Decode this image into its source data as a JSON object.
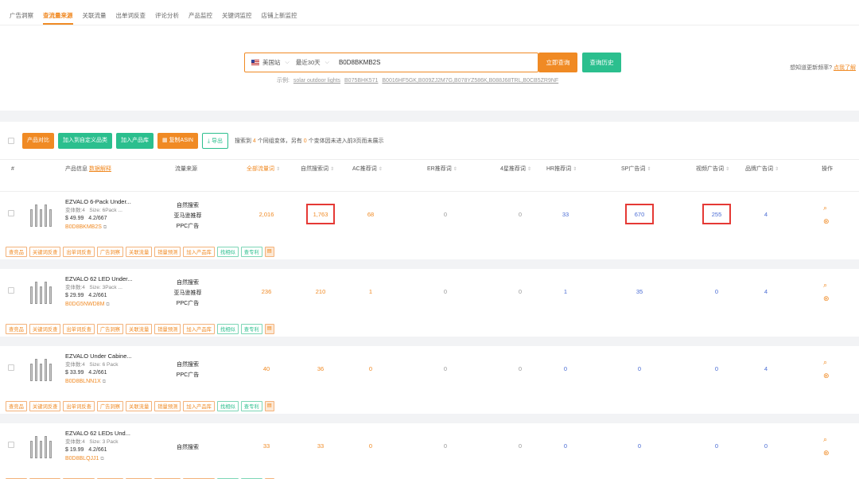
{
  "tabs": [
    "广告洞察",
    "查流量来源",
    "关联流量",
    "出单词反查",
    "评论分析",
    "产品监控",
    "关键词监控",
    "店铺上新监控"
  ],
  "active_tab": 1,
  "search": {
    "site": "美国站",
    "range": "最近30天",
    "asin": "B0D8BKMB2S",
    "query_button": "立即查询",
    "history_button": "查询历史",
    "example_label": "示例:",
    "examples": [
      "solar outdoor lights",
      "B075BHK571",
      "B0016HF5GK,B009ZJ2M7G,B078YZ586K,B088J68TRL,B0CB5ZR9NF"
    ],
    "freq_text": "想知道更新频率?",
    "freq_link": "点我了解"
  },
  "toolbar": {
    "compare": "产品对比",
    "add_category": "加入到自定义品类",
    "add_library": "加入产品库",
    "copy_asin": "复制ASIN",
    "export": "导出",
    "info_prefix": "搜索到",
    "info_count": "4",
    "info_mid": "个同组变体，另有",
    "info_count2": "0",
    "info_suffix": "个变体因未进入前3页而未展示"
  },
  "columns": {
    "index": "#",
    "product": "产品信息",
    "product_link": "数据解释",
    "source": "流量来源",
    "total": "全部流量词",
    "organic": "自然搜索词",
    "ac": "AC推荐词",
    "er": "ER推荐词",
    "four_star": "4星推荐词",
    "hr": "HR推荐词",
    "sp": "SP广告词",
    "video": "视频广告词",
    "brand": "品牌广告词",
    "ops": "操作"
  },
  "tags": [
    "查竞品",
    "关键词反查",
    "出单词反查",
    "广告洞察",
    "关联流量",
    "销量预测",
    "加入产品库",
    "找相似",
    "查专利"
  ],
  "products": [
    {
      "name": "EZVALO 6-Pack Under...",
      "variants": "变体数:4",
      "size": "Size: 6Pack ...",
      "price": "$ 49.99",
      "rating": "4.2/667",
      "asin": "B0D8BKMB2S",
      "sources": [
        "自然搜索",
        "亚马逊推荐",
        "PPC广告"
      ],
      "total": "2,016",
      "organic": "1,763",
      "ac": "68",
      "er": "0",
      "four_star": "0",
      "hr": "33",
      "sp": "670",
      "video": "255",
      "brand": "4"
    },
    {
      "name": "EZVALO 62 LED Under...",
      "variants": "变体数:4",
      "size": "Size: 3Pack ...",
      "price": "$ 29.99",
      "rating": "4.2/661",
      "asin": "B0DG5NWD8M",
      "sources": [
        "自然搜索",
        "亚马逊推荐",
        "PPC广告"
      ],
      "total": "236",
      "organic": "210",
      "ac": "1",
      "er": "0",
      "four_star": "0",
      "hr": "1",
      "sp": "35",
      "video": "0",
      "brand": "4"
    },
    {
      "name": "EZVALO Under Cabine...",
      "variants": "变体数:4",
      "size": "Size: 6 Pack",
      "price": "$ 33.99",
      "rating": "4.2/661",
      "asin": "B0D8BLNN1X",
      "sources": [
        "自然搜索",
        "PPC广告"
      ],
      "total": "40",
      "organic": "36",
      "ac": "0",
      "er": "0",
      "four_star": "0",
      "hr": "0",
      "sp": "0",
      "video": "0",
      "brand": "4"
    },
    {
      "name": "EZVALO 62 LEDs Und...",
      "variants": "变体数:4",
      "size": "Size: 3 Pack",
      "price": "$ 19.99",
      "rating": "4.2/661",
      "asin": "B0D8BLQJJ1",
      "sources": [
        "自然搜索"
      ],
      "total": "33",
      "organic": "33",
      "ac": "0",
      "er": "0",
      "four_star": "0",
      "hr": "0",
      "sp": "0",
      "video": "0",
      "brand": "0"
    }
  ],
  "colors": {
    "accent": "#f08a24",
    "green": "#2bbf8e",
    "blue": "#4a6cd4",
    "highlight": "#e53935"
  }
}
